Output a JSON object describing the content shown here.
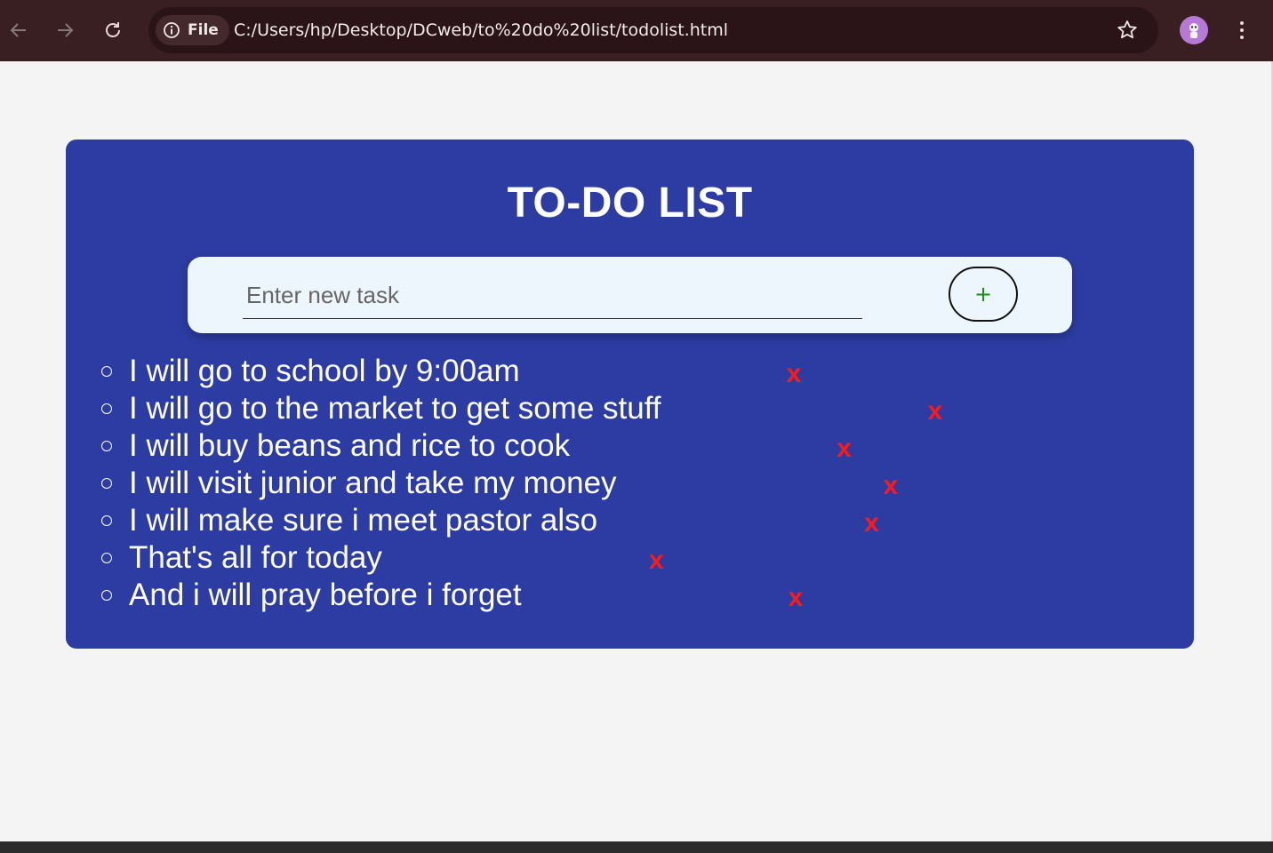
{
  "browser": {
    "chip_label": "File",
    "url": "C:/Users/hp/Desktop/DCweb/to%20do%20list/todolist.html",
    "icons": [
      "back-arrow-icon",
      "forward-arrow-icon",
      "reload-icon",
      "info-icon",
      "star-icon",
      "avatar-icon",
      "kebab-menu-icon"
    ]
  },
  "app": {
    "title": "TO-DO LIST",
    "input_placeholder": "Enter new task",
    "input_value": "",
    "add_button_label": "+",
    "delete_label": "x",
    "tasks": [
      {
        "text": "I will go to school by 9:00am"
      },
      {
        "text": "I will go to the market to get some stuff"
      },
      {
        "text": "I will buy beans and rice to cook"
      },
      {
        "text": "I will visit junior and take my money"
      },
      {
        "text": "I will make sure i meet pastor also"
      },
      {
        "text": "That's all for today"
      },
      {
        "text": "And i will pray before i forget"
      }
    ]
  },
  "colors": {
    "chrome_bg": "#3a1f22",
    "card_bg": "#2c3ca2",
    "input_bg": "#eef6fd",
    "delete": "#ff1a1a",
    "add_plus": "#1a8c1a"
  }
}
